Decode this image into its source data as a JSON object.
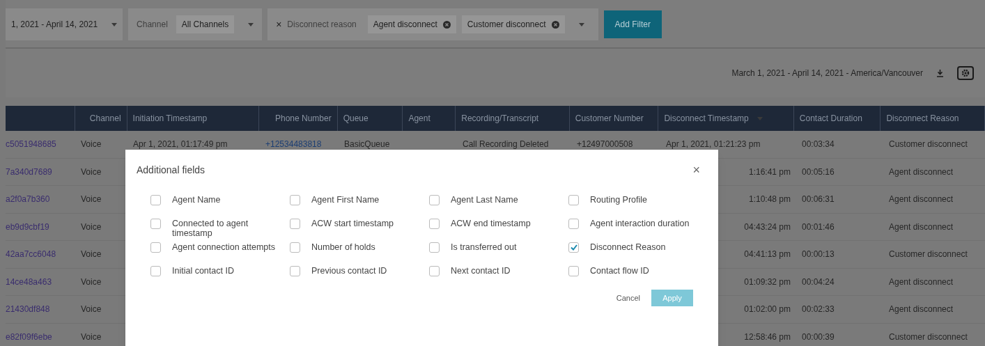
{
  "filters": {
    "date_range": {
      "value": "1, 2021 - April 14, 2021"
    },
    "channel": {
      "label": "Channel",
      "value": "All Channels"
    },
    "disconnect_reason": {
      "remove": "×",
      "label": "Disconnect reason",
      "chips": [
        "Agent disconnect",
        "Customer disconnect"
      ]
    },
    "add_filter": "Add Filter"
  },
  "report_range": "March 1, 2021 - April 14, 2021 - America/Vancouver",
  "table": {
    "columns": [
      {
        "sorted": false
      },
      {
        "label": "Channel",
        "sorted": false
      },
      {
        "label": "Initiation Timestamp",
        "sorted": false
      },
      {
        "label": "Phone Number",
        "sorted": false
      },
      {
        "label": "Queue",
        "sorted": false
      },
      {
        "label": "Agent",
        "sorted": false
      },
      {
        "label": "Recording/Transcript",
        "sorted": false
      },
      {
        "label": "Customer Number",
        "sorted": false
      },
      {
        "label": "Disconnect Timestamp",
        "sorted": true
      },
      {
        "label": "Contact Duration",
        "sorted": false
      },
      {
        "label": "Disconnect Reason",
        "sorted": false
      }
    ],
    "rows": [
      {
        "contact_id": "c5051948685",
        "channel": "Voice",
        "initiation": "Apr 1, 2021, 01:17:49 pm",
        "phone": "+12534483818",
        "queue": "BasicQueue",
        "recording": "Call Recording Deleted",
        "customer_number": "+12497000508",
        "disconnect": "Apr 1, 2021, 01:21:23 pm",
        "duration": "00:03:34",
        "reason": "Customer disconnect"
      },
      {
        "contact_id": "7a340d7689",
        "channel": "Voice",
        "disconnect": "1:16:41 pm",
        "duration": "00:05:16",
        "reason": "Agent disconnect"
      },
      {
        "contact_id": "a2f0a7b360",
        "channel": "Voice",
        "disconnect": "1:10:48 pm",
        "duration": "00:06:31",
        "reason": "Agent disconnect"
      },
      {
        "contact_id": "eb9d9cbf19",
        "channel": "Voice",
        "disconnect": "04:43:24 pm",
        "duration": "00:01:46",
        "reason": "Agent disconnect"
      },
      {
        "contact_id": "42aa7cc6048",
        "channel": "Voice",
        "disconnect": "04:41:13 pm",
        "duration": "00:00:13",
        "reason": "Customer disconnect"
      },
      {
        "contact_id": "14ce48a463",
        "channel": "Voice",
        "disconnect": "01:09:32 pm",
        "duration": "00:04:24",
        "reason": "Agent disconnect"
      },
      {
        "contact_id": "21430df848",
        "channel": "Voice",
        "disconnect": "01:02:00 pm",
        "duration": "00:02:33",
        "reason": "Agent disconnect"
      },
      {
        "contact_id": "e82f09f6ebe",
        "channel": "Voice",
        "disconnect": "12:58:46 pm",
        "duration": "00:00:39",
        "reason": "Customer disconnect"
      }
    ]
  },
  "dialog": {
    "title": "Additional fields",
    "close": "×",
    "fields": [
      {
        "label": "Agent Name",
        "checked": false
      },
      {
        "label": "Agent First Name",
        "checked": false
      },
      {
        "label": "Agent Last Name",
        "checked": false
      },
      {
        "label": "Routing Profile",
        "checked": false
      },
      {
        "label": "Connected to agent timestamp",
        "checked": false
      },
      {
        "label": "ACW start timestamp",
        "checked": false
      },
      {
        "label": "ACW end timestamp",
        "checked": false
      },
      {
        "label": "Agent interaction duration",
        "checked": false
      },
      {
        "label": "Agent connection attempts",
        "checked": false
      },
      {
        "label": "Number of holds",
        "checked": false
      },
      {
        "label": "Is transferred out",
        "checked": false
      },
      {
        "label": "Disconnect Reason",
        "checked": true
      },
      {
        "label": "Initial contact ID",
        "checked": false
      },
      {
        "label": "Previous contact ID",
        "checked": false
      },
      {
        "label": "Next contact ID",
        "checked": false
      },
      {
        "label": "Contact flow ID",
        "checked": false
      }
    ],
    "cancel": "Cancel",
    "apply": {
      "label": "Apply",
      "disabled": true
    }
  }
}
